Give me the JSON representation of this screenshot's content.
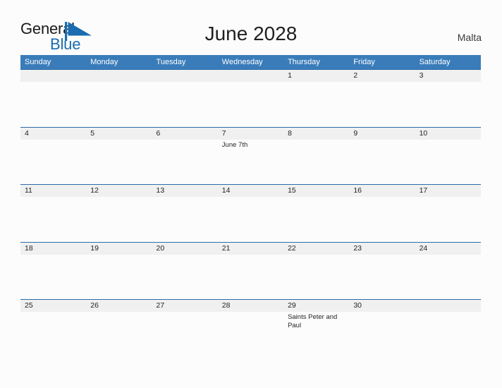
{
  "logo": {
    "word_one": "General",
    "word_two": "Blue",
    "flag_icon": "blue-flag-triangle-icon",
    "accent_color": "#1b6cb0"
  },
  "header": {
    "title": "June 2028",
    "country": "Malta"
  },
  "colors": {
    "header_blue": "#3a7cba",
    "row_rule_blue": "#2b6ca8",
    "date_strip_gray": "#f0f0f0",
    "page_background": "#fcfcfc"
  },
  "calendar": {
    "weekdays": [
      "Sunday",
      "Monday",
      "Tuesday",
      "Wednesday",
      "Thursday",
      "Friday",
      "Saturday"
    ],
    "weeks": [
      [
        {
          "day": "",
          "event": ""
        },
        {
          "day": "",
          "event": ""
        },
        {
          "day": "",
          "event": ""
        },
        {
          "day": "",
          "event": ""
        },
        {
          "day": "1",
          "event": ""
        },
        {
          "day": "2",
          "event": ""
        },
        {
          "day": "3",
          "event": ""
        }
      ],
      [
        {
          "day": "4",
          "event": ""
        },
        {
          "day": "5",
          "event": ""
        },
        {
          "day": "6",
          "event": ""
        },
        {
          "day": "7",
          "event": "June 7th"
        },
        {
          "day": "8",
          "event": ""
        },
        {
          "day": "9",
          "event": ""
        },
        {
          "day": "10",
          "event": ""
        }
      ],
      [
        {
          "day": "11",
          "event": ""
        },
        {
          "day": "12",
          "event": ""
        },
        {
          "day": "13",
          "event": ""
        },
        {
          "day": "14",
          "event": ""
        },
        {
          "day": "15",
          "event": ""
        },
        {
          "day": "16",
          "event": ""
        },
        {
          "day": "17",
          "event": ""
        }
      ],
      [
        {
          "day": "18",
          "event": ""
        },
        {
          "day": "19",
          "event": ""
        },
        {
          "day": "20",
          "event": ""
        },
        {
          "day": "21",
          "event": ""
        },
        {
          "day": "22",
          "event": ""
        },
        {
          "day": "23",
          "event": ""
        },
        {
          "day": "24",
          "event": ""
        }
      ],
      [
        {
          "day": "25",
          "event": ""
        },
        {
          "day": "26",
          "event": ""
        },
        {
          "day": "27",
          "event": ""
        },
        {
          "day": "28",
          "event": ""
        },
        {
          "day": "29",
          "event": "Saints Peter and Paul"
        },
        {
          "day": "30",
          "event": ""
        },
        {
          "day": "",
          "event": ""
        }
      ]
    ]
  }
}
